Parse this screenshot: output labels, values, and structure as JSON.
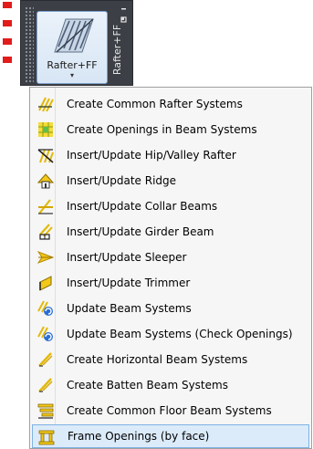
{
  "ribbon": {
    "button_label": "Rafter+FF",
    "dropdown_caret": "▾",
    "panel_tab_label": "Rafter+FF"
  },
  "menu": {
    "items": [
      {
        "label": "Create Common Rafter Systems",
        "icon": "common-rafter-icon"
      },
      {
        "label": "Create Openings in Beam Systems",
        "icon": "beam-openings-icon"
      },
      {
        "label": "Insert/Update Hip/Valley Rafter",
        "icon": "hip-valley-rafter-icon"
      },
      {
        "label": "Insert/Update Ridge",
        "icon": "ridge-icon"
      },
      {
        "label": "Insert/Update Collar Beams",
        "icon": "collar-beam-icon"
      },
      {
        "label": "Insert/Update Girder Beam",
        "icon": "girder-beam-icon"
      },
      {
        "label": "Insert/Update Sleeper",
        "icon": "sleeper-icon"
      },
      {
        "label": "Insert/Update Trimmer",
        "icon": "trimmer-icon"
      },
      {
        "label": "Update Beam Systems",
        "icon": "update-beam-systems-icon"
      },
      {
        "label": "Update Beam Systems (Check Openings)",
        "icon": "update-beam-systems-check-icon"
      },
      {
        "label": "Create Horizontal Beam Systems",
        "icon": "horizontal-beam-icon"
      },
      {
        "label": "Create Batten Beam Systems",
        "icon": "batten-beam-icon"
      },
      {
        "label": "Create Common Floor Beam Systems",
        "icon": "floor-beam-icon"
      },
      {
        "label": "Frame Openings (by face)",
        "icon": "frame-openings-icon"
      }
    ],
    "highlighted_label": "Frame Openings (by face)"
  },
  "colors": {
    "panel_bg": "#3c3f45",
    "highlight_bg": "#dcebfa",
    "highlight_border": "#7fb2e5",
    "icon_yellow": "#f2d21c",
    "annotation_red": "#e21b1b"
  }
}
